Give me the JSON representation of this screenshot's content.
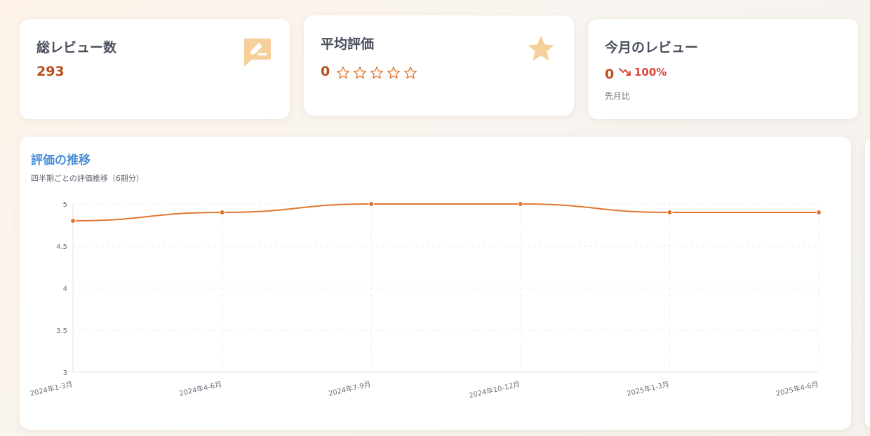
{
  "stats": {
    "total_reviews": {
      "title": "総レビュー数",
      "value": "293",
      "icon": "edit-comment-icon"
    },
    "average_rating": {
      "title": "平均評価",
      "value": "0",
      "stars_filled": 0,
      "stars_total": 5,
      "icon": "star-icon"
    },
    "monthly_reviews": {
      "title": "今月のレビュー",
      "value": "0",
      "trend": "100%",
      "trend_direction": "down",
      "caption": "先月比"
    }
  },
  "colors": {
    "accent_orange": "#e0772e",
    "value_text": "#b84f1e",
    "icon_peach": "#f7cf9a",
    "trend_red": "#d9473a",
    "chart_title_blue": "#4a90d9"
  },
  "chart": {
    "title": "評価の推移",
    "subtitle": "四半期ごとの評価推移（6期分）"
  },
  "chart_data": {
    "type": "line",
    "categories": [
      "2024年1-3月",
      "2024年4-6月",
      "2024年7-9月",
      "2024年10-12月",
      "2025年1-3月",
      "2025年4-6月"
    ],
    "series": [
      {
        "values": [
          4.8,
          4.9,
          5.0,
          5.0,
          4.9,
          4.9
        ]
      }
    ],
    "ylim": [
      3,
      5
    ],
    "yticks": [
      "3",
      "3.5",
      "4",
      "4.5",
      "5"
    ],
    "grid": true
  }
}
